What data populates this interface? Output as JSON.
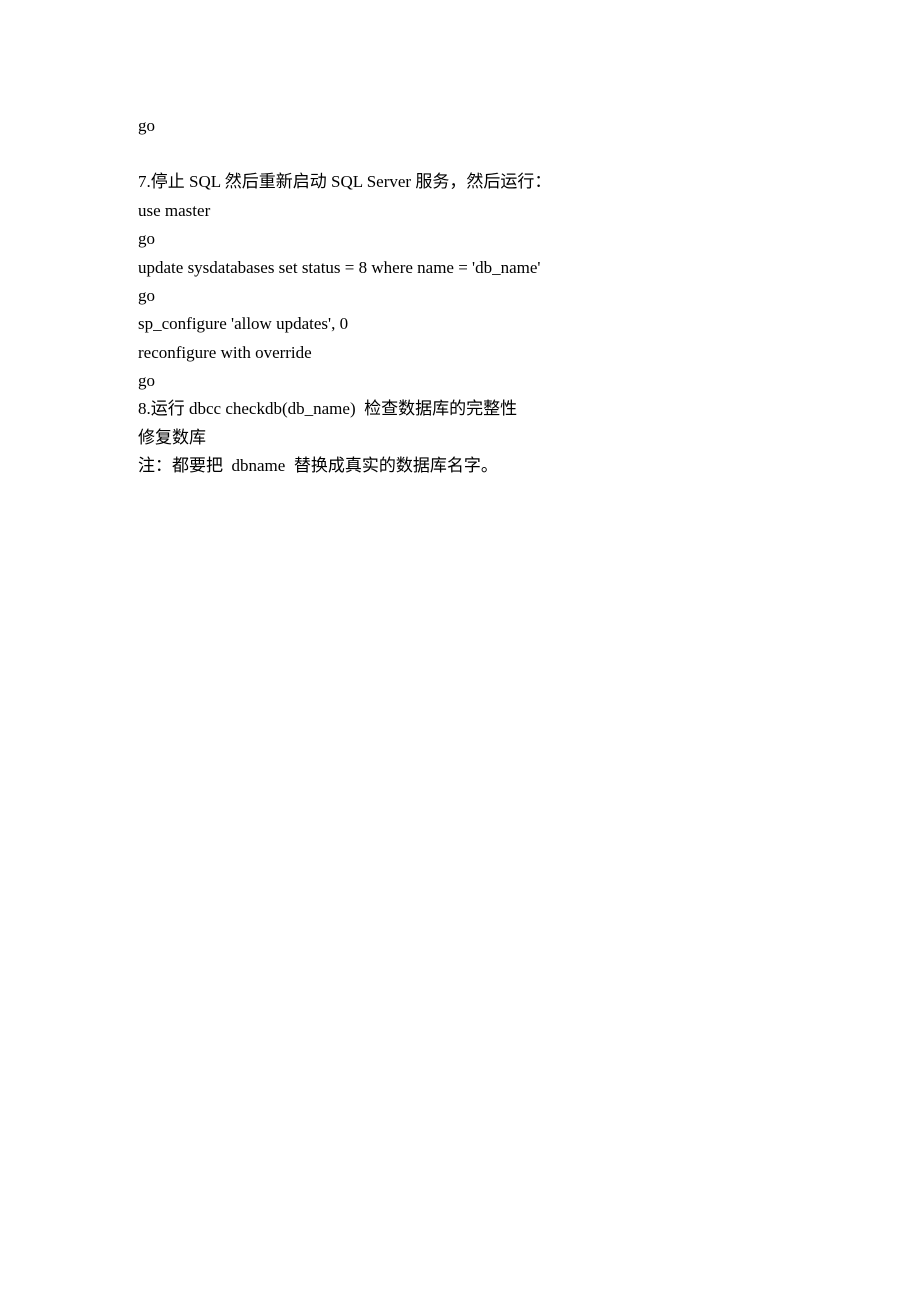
{
  "lines": [
    "go",
    "",
    "7.停止 SQL 然后重新启动 SQL Server 服务，然后运行：",
    "use master",
    "go",
    "update sysdatabases set status = 8 where name = 'db_name'",
    "go",
    "sp_configure 'allow updates', 0",
    "reconfigure with override",
    "go",
    "8.运行 dbcc checkdb(db_name)  检查数据库的完整性",
    "修复数库",
    "注：都要把  dbname  替换成真实的数据库名字。"
  ]
}
